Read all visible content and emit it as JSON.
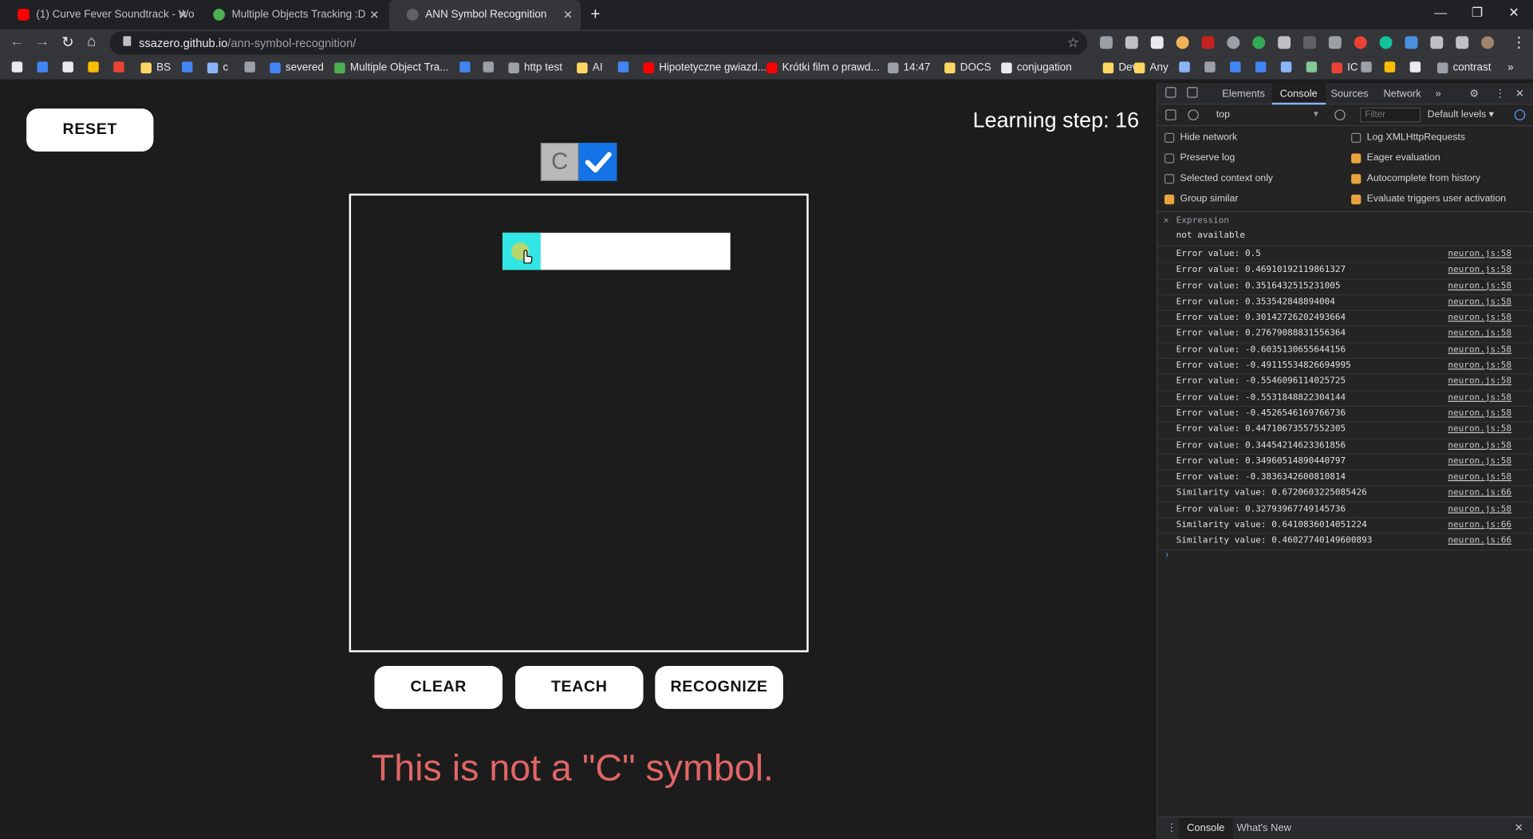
{
  "browser": {
    "tabs": [
      {
        "title": "(1) Curve Fever Soundtrack - Wo",
        "active": false,
        "favicon_color": "#ff0000"
      },
      {
        "title": "Multiple Objects Tracking :D",
        "active": false,
        "favicon_color": "#4caf50"
      },
      {
        "title": "ANN Symbol Recognition",
        "active": true,
        "favicon_color": "#5f6368"
      }
    ],
    "url_host": "ssazero.github.io",
    "url_path": "/ann-symbol-recognition/",
    "bookmarks": [
      {
        "label": "",
        "color": "#e8eaed"
      },
      {
        "label": "",
        "color": "#4285f4"
      },
      {
        "label": "",
        "color": "#e8eaed"
      },
      {
        "label": "",
        "color": "#fbbc04"
      },
      {
        "label": "",
        "color": "#ea4335"
      },
      {
        "label": "BS",
        "color": "#fdd663"
      },
      {
        "label": "",
        "color": "#4285f4"
      },
      {
        "label": "c",
        "color": "#8ab4f8"
      },
      {
        "label": "",
        "color": "#9aa0a6"
      },
      {
        "label": "severed",
        "color": "#4285f4"
      },
      {
        "label": "Multiple Object Tra...",
        "color": "#4caf50"
      },
      {
        "label": "",
        "color": "#4285f4"
      },
      {
        "label": "",
        "color": "#9aa0a6"
      },
      {
        "label": "http test",
        "color": "#9aa0a6"
      },
      {
        "label": "AI",
        "color": "#fdd663"
      },
      {
        "label": "",
        "color": "#4285f4"
      },
      {
        "label": "Hipotetyczne gwiazd...",
        "color": "#ff0000"
      },
      {
        "label": "Krótki film o prawd...",
        "color": "#ff0000"
      },
      {
        "label": "14:47",
        "color": "#9aa0a6"
      },
      {
        "label": "DOCS",
        "color": "#fdd663"
      },
      {
        "label": "conjugation",
        "color": "#e8eaed"
      },
      {
        "label": "Dev",
        "color": "#fdd663"
      },
      {
        "label": "Any",
        "color": "#fdd663"
      },
      {
        "label": "",
        "color": "#8ab4f8"
      },
      {
        "label": "",
        "color": "#9aa0a6"
      },
      {
        "label": "",
        "color": "#4285f4"
      },
      {
        "label": "",
        "color": "#4285f4"
      },
      {
        "label": "",
        "color": "#8ab4f8"
      },
      {
        "label": "",
        "color": "#81c995"
      },
      {
        "label": "IC",
        "color": "#ea4335"
      },
      {
        "label": "",
        "color": "#9aa0a6"
      },
      {
        "label": "",
        "color": "#fbbc04"
      },
      {
        "label": "",
        "color": "#e8eaed"
      },
      {
        "label": "contrast",
        "color": "#9aa0a6"
      }
    ]
  },
  "app": {
    "reset_label": "RESET",
    "learning_step": "Learning step: 16",
    "symbol": "C",
    "checkbox_checked": true,
    "buttons": {
      "clear": "CLEAR",
      "teach": "TEACH",
      "recognize": "RECOGNIZE"
    },
    "result_message": "This is not a \"C\" symbol.",
    "result_color": "#e06666",
    "accent_color": "#1473e6"
  },
  "devtools": {
    "tabs": [
      "Elements",
      "Console",
      "Sources",
      "Network"
    ],
    "active_tab": "Console",
    "context": "top",
    "filter_placeholder": "Filter",
    "levels": "Default levels",
    "options": [
      {
        "label": "Hide network",
        "checked": false
      },
      {
        "label": "Log XMLHttpRequests",
        "checked": false
      },
      {
        "label": "Preserve log",
        "checked": false
      },
      {
        "label": "Eager evaluation",
        "checked": true
      },
      {
        "label": "Selected context only",
        "checked": false
      },
      {
        "label": "Autocomplete from history",
        "checked": true
      },
      {
        "label": "Group similar",
        "checked": true
      },
      {
        "label": "Evaluate triggers user activation",
        "checked": true
      }
    ],
    "expression_label": "Expression",
    "expression_value": "not available",
    "logs": [
      {
        "msg": "Error value: 0.5",
        "src": "neuron.js:58"
      },
      {
        "msg": "Error value: 0.46910192119861327",
        "src": "neuron.js:58"
      },
      {
        "msg": "Error value: 0.3516432515231005",
        "src": "neuron.js:58"
      },
      {
        "msg": "Error value: 0.353542848894004",
        "src": "neuron.js:58"
      },
      {
        "msg": "Error value: 0.30142726202493664",
        "src": "neuron.js:58"
      },
      {
        "msg": "Error value: 0.27679088831556364",
        "src": "neuron.js:58"
      },
      {
        "msg": "Error value: -0.6035130655644156",
        "src": "neuron.js:58"
      },
      {
        "msg": "Error value: -0.49115534826694995",
        "src": "neuron.js:58"
      },
      {
        "msg": "Error value: -0.5546096114025725",
        "src": "neuron.js:58"
      },
      {
        "msg": "Error value: -0.5531848822304144",
        "src": "neuron.js:58"
      },
      {
        "msg": "Error value: -0.4526546169766736",
        "src": "neuron.js:58"
      },
      {
        "msg": "Error value: 0.44710673557552305",
        "src": "neuron.js:58"
      },
      {
        "msg": "Error value: 0.34454214623361856",
        "src": "neuron.js:58"
      },
      {
        "msg": "Error value: 0.34960514890440797",
        "src": "neuron.js:58"
      },
      {
        "msg": "Error value: -0.3836342600810814",
        "src": "neuron.js:58"
      },
      {
        "msg": "Similarity value: 0.6720603225085426",
        "src": "neuron.js:66"
      },
      {
        "msg": "Error value: 0.32793967749145736",
        "src": "neuron.js:58"
      },
      {
        "msg": "Similarity value: 0.6410836014051224",
        "src": "neuron.js:66"
      },
      {
        "msg": "Similarity value: 0.46027740149600893",
        "src": "neuron.js:66"
      }
    ],
    "drawer_tabs": [
      "Console",
      "What's New"
    ]
  }
}
